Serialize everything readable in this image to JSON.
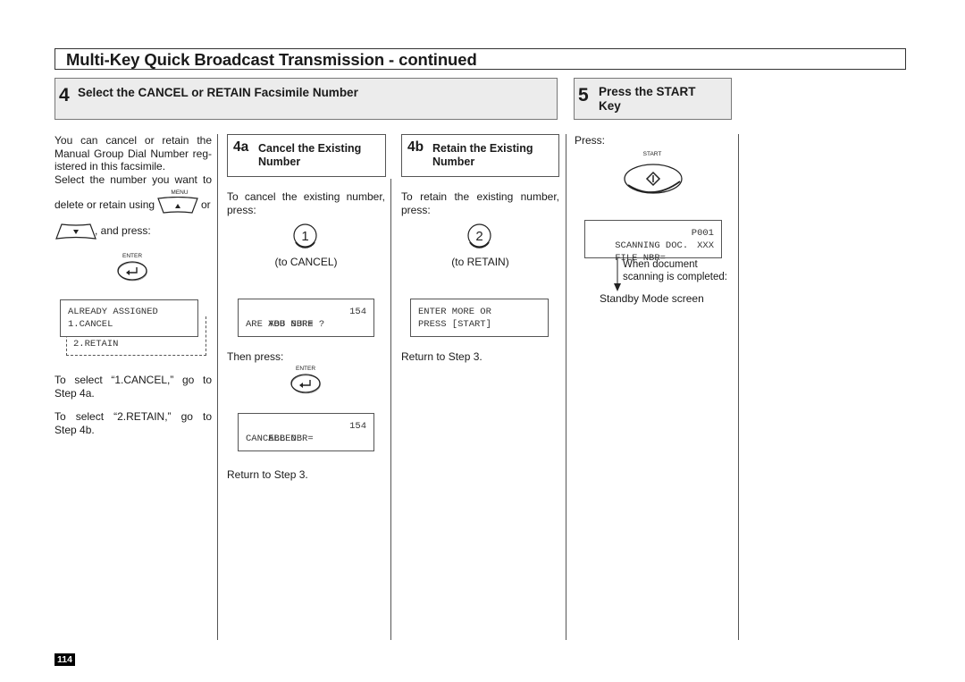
{
  "page_title": "Multi-Key Quick Broadcast Transmission - continued",
  "step4": {
    "number": "4",
    "label": "Select the CANCEL or RETAIN Facsimile Number",
    "intro_lines": [
      "You can cancel or retain the",
      "Manual Group Dial Number reg-",
      "istered in this facsimile.",
      "Select the number you want to"
    ],
    "delete_text": "delete or retain using",
    "or_text": "or",
    "and_press_text": ", and press:",
    "menu_key_label": "MENU",
    "enter_key_label": "ENTER",
    "lcd": {
      "line1": "ALREADY ASSIGNED",
      "line2": "1.CANCEL",
      "line3": "2.RETAIN"
    },
    "select_cancel_line1": "To select “1.CANCEL,” go to",
    "select_cancel_line2": "Step 4a.",
    "select_retain_line1": "To select “2.RETAIN,” go to",
    "select_retain_line2": "Step 4b."
  },
  "step4a": {
    "number": "4a",
    "label_line1": "Cancel the Existing",
    "label_line2": "Number",
    "intro_line1": "To cancel the existing number,",
    "intro_line2": "press:",
    "key": "1",
    "key_caption": "(to CANCEL)",
    "lcd1": {
      "line1_left": "ABB NBR=",
      "line1_right": "154",
      "line2": "ARE YOU SURE ?"
    },
    "then_press": "Then press:",
    "enter_key_label": "ENTER",
    "lcd2": {
      "line1_left": "ABB NBR=",
      "line1_right": "154",
      "line2": "CANCELLED"
    },
    "return_text": "Return to Step 3."
  },
  "step4b": {
    "number": "4b",
    "label_line1": "Retain the Existing",
    "label_line2": "Number",
    "intro_line1": "To retain the existing number,",
    "intro_line2": "press:",
    "key": "2",
    "key_caption": "(to RETAIN)",
    "lcd": {
      "line1": "ENTER MORE OR",
      "line2": "PRESS [START]"
    },
    "return_text": "Return to Step 3."
  },
  "step5": {
    "number": "5",
    "label_line1": "Press the START",
    "label_line2": "Key",
    "press_text": "Press:",
    "start_key_label": "START",
    "lcd": {
      "line1_left": "SCANNING DOC.",
      "line1_right": "P001",
      "line2_left": "FILE NBR=",
      "line2_right": "XXX"
    },
    "note_line1": "When document",
    "note_line2": "scanning is completed:",
    "result_text": "Standby Mode screen"
  },
  "page_number": "114",
  "icons": {
    "menu_up": "triangle-up-key",
    "down": "triangle-down-key",
    "enter": "return-arrow-key",
    "start": "diamond-start-key"
  }
}
